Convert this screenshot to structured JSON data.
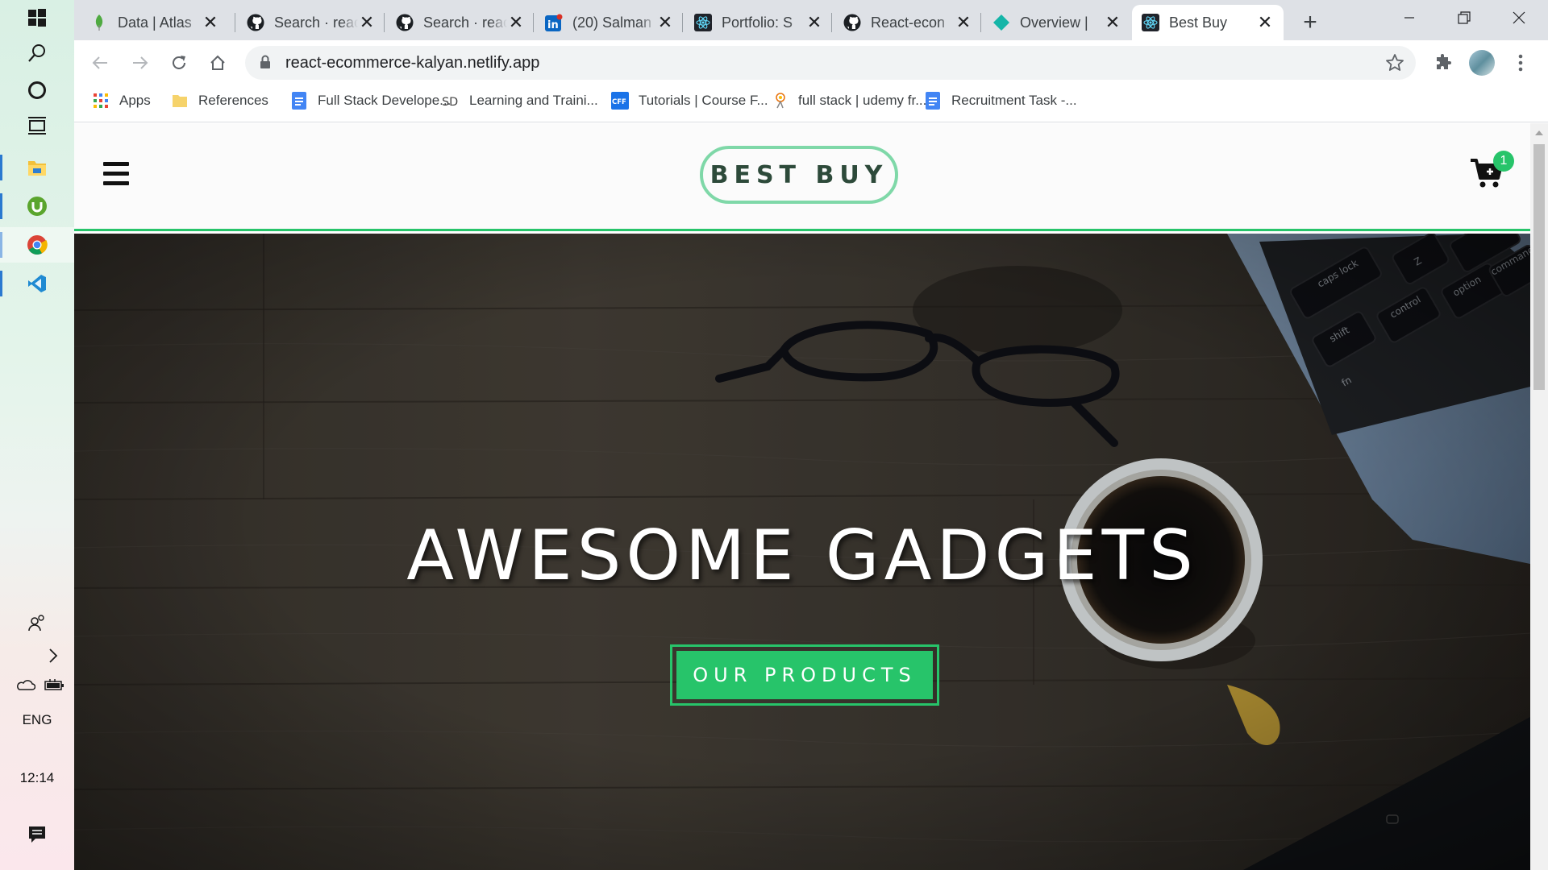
{
  "taskbar": {
    "language": "ENG",
    "clock": "12:14",
    "icons": [
      "windows-start-icon",
      "search-icon",
      "cortana-icon",
      "task-view-icon",
      "file-explorer-icon",
      "utorrent-icon",
      "chrome-icon",
      "vscode-icon",
      "people-icon",
      "chevron-right-icon",
      "onedrive-icon",
      "battery-icon",
      "notification-icon"
    ]
  },
  "browser": {
    "tabs": [
      {
        "title": "Data | Atlas",
        "icon": "mongodb-leaf-icon"
      },
      {
        "title": "Search · react",
        "icon": "github-icon"
      },
      {
        "title": "Search · react",
        "icon": "github-icon"
      },
      {
        "title": "(20) Salman",
        "icon": "linkedin-icon"
      },
      {
        "title": "Portfolio: S",
        "icon": "react-icon"
      },
      {
        "title": "React-econ",
        "icon": "github-icon"
      },
      {
        "title": "Overview |",
        "icon": "netlify-icon"
      },
      {
        "title": "Best Buy",
        "icon": "react-icon",
        "active": true
      }
    ],
    "url": "react-ecommerce-kalyan.netlify.app",
    "bookmarks": [
      {
        "label": "Apps",
        "icon": "apps-grid-icon"
      },
      {
        "label": "References",
        "icon": "folder-icon"
      },
      {
        "label": "Full Stack Develope...",
        "icon": "google-docs-icon"
      },
      {
        "label": "Learning and Traini...",
        "icon": "sd-icon"
      },
      {
        "label": "Tutorials | Course F...",
        "icon": "cff-icon"
      },
      {
        "label": "full stack | udemy fr...",
        "icon": "udemy-icon"
      },
      {
        "label": "Recruitment Task -...",
        "icon": "google-docs-icon"
      }
    ],
    "accent": "#27c46a"
  },
  "site": {
    "logo": "BEST BUY",
    "cart_count": "1",
    "hero_title": "AWESOME GADGETS",
    "hero_button": "OUR PRODUCTS"
  }
}
